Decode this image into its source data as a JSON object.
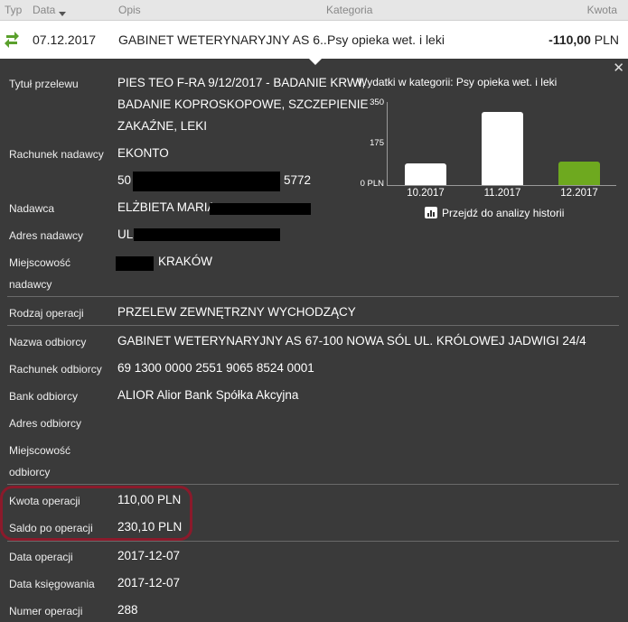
{
  "header": {
    "type": "Typ",
    "date": "Data",
    "desc": "Opis",
    "category": "Kategoria",
    "amount": "Kwota"
  },
  "transaction": {
    "date": "07.12.2017",
    "desc": "GABINET WETERYNARYJNY AS 6...",
    "category": "Psy opieka wet. i leki",
    "amount_value": "-110,00",
    "amount_currency": "PLN"
  },
  "details": {
    "title_label": "Tytuł przelewu",
    "title_lines": [
      "PIES TEO F-RA 9/12/2017 - BADANIE KRWI,",
      "BADANIE KOPROSKOPOWE, SZCZEPIENIE",
      "ZAKAŹNE, LEKI"
    ],
    "sender_account_label": "Rachunek nadawcy",
    "sender_account_name": "EKONTO",
    "sender_account_prefix": "50",
    "sender_account_suffix": "5772",
    "sender_label": "Nadawca",
    "sender_value": "ELŻBIETA MARIA",
    "sender_address_label": "Adres nadawcy",
    "sender_address_value": "UL",
    "sender_city_label_1": "Miejscowość",
    "sender_city_label_2": "nadawcy",
    "sender_city_value": "KRAKÓW",
    "op_type_label": "Rodzaj operacji",
    "op_type_value": "PRZELEW ZEWNĘTRZNY WYCHODZĄCY",
    "recipient_name_label": "Nazwa odbiorcy",
    "recipient_name_value": "GABINET WETERYNARYJNY AS 67-100 NOWA SÓL UL. KRÓLOWEJ JADWIGI 24/4",
    "recipient_account_label": "Rachunek odbiorcy",
    "recipient_account_value": "69 1300 0000 2551 9065 8524 0001",
    "recipient_bank_label": "Bank odbiorcy",
    "recipient_bank_value": "ALIOR Alior Bank Spółka Akcyjna",
    "recipient_address_label": "Adres odbiorcy",
    "recipient_city_label_1": "Miejscowość",
    "recipient_city_label_2": "odbiorcy",
    "op_amount_label": "Kwota operacji",
    "op_amount_value": "110,00 PLN",
    "balance_label": "Saldo po operacji",
    "balance_value": "230,10 PLN",
    "op_date_label": "Data operacji",
    "op_date_value": "2017-12-07",
    "book_date_label": "Data księgowania",
    "book_date_value": "2017-12-07",
    "op_number_label": "Numer operacji",
    "op_number_value": "288"
  },
  "chart_data": {
    "type": "bar",
    "title": "Wydatki w kategorii:  Psy opieka wet. i leki",
    "categories": [
      "10.2017",
      "11.2017",
      "12.2017"
    ],
    "values": [
      90,
      310,
      100
    ],
    "yticks": [
      "350",
      "175",
      "0 PLN"
    ],
    "ylim": [
      0,
      350
    ],
    "colors": [
      "#ffffff",
      "#ffffff",
      "#6ea91f"
    ],
    "link_label": "Przejdź do analizy historii"
  },
  "icons": {
    "type_icon": "transfer-arrows-icon",
    "close": "close-icon",
    "history": "bar-chart-icon"
  },
  "accent": "#8b1a2b"
}
